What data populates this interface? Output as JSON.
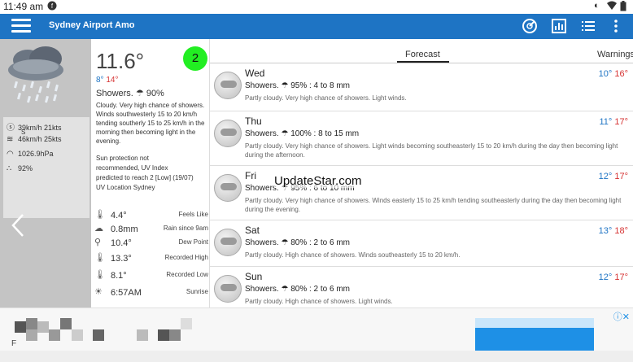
{
  "status_bar": {
    "time": "11:49 am"
  },
  "app_bar": {
    "title": "Sydney Airport Amo",
    "icons": [
      "menu-icon",
      "radar-icon",
      "chart-icon",
      "list-icon",
      "more-vert-icon"
    ]
  },
  "current": {
    "temp": "11.6°",
    "badge": "2",
    "min": "8°",
    "max": "14°",
    "summary": "Showers. ☂ 90%",
    "description": "Cloudy. Very high chance of showers. Winds southwesterly 15 to 20 km/h tending southerly 15 to 25 km/h in the morning then becoming light in the evening.",
    "sun_protection": "Sun protection not recommended, UV Index predicted to reach 2 [Low] (19/07)",
    "uv_location": "UV Location Sydney"
  },
  "left_stats": {
    "wind": "39km/h 21kts",
    "wind_dir": "S",
    "gust": "46km/h 25kts",
    "pressure": "1026.9hPa",
    "humidity": "92%"
  },
  "observations": [
    {
      "icon": "thermometer-person-icon",
      "value": "4.4°",
      "label": "Feels Like"
    },
    {
      "icon": "rain-cloud-icon",
      "value": "0.8mm",
      "label": "Rain since 9am"
    },
    {
      "icon": "dew-point-icon",
      "value": "10.4°",
      "label": "Dew Point"
    },
    {
      "icon": "thermometer-high-icon",
      "value": "13.3°",
      "label": "Recorded High"
    },
    {
      "icon": "thermometer-low-icon",
      "value": "8.1°",
      "label": "Recorded Low"
    },
    {
      "icon": "sunrise-icon",
      "value": "6:57AM",
      "label": "Sunrise"
    }
  ],
  "tabs": {
    "forecast": "Forecast",
    "warnings": "Warnings"
  },
  "forecast": [
    {
      "day": "Wed",
      "summary": "Showers. ☂ 95% : 4 to 8 mm",
      "desc": "Partly cloudy. Very high chance of showers. Light winds.",
      "min": "10°",
      "max": "16°"
    },
    {
      "day": "Thu",
      "summary": "Showers. ☂ 100% : 8 to 15 mm",
      "desc": "Partly cloudy. Very high chance of showers. Light winds becoming southeasterly 15 to 20 km/h during the day then becoming light during the afternoon.",
      "min": "11°",
      "max": "17°"
    },
    {
      "day": "Fri",
      "summary": "Showers. ☂ 95% : 6 to 10 mm",
      "desc": "Partly cloudy. Very high chance of showers. Winds easterly 15 to 25 km/h tending southeasterly during the day then becoming light during the evening.",
      "min": "12°",
      "max": "17°"
    },
    {
      "day": "Sat",
      "summary": "Showers. ☂ 80% : 2 to 6 mm",
      "desc": "Partly cloudy. High chance of showers. Winds southeasterly 15 to 20 km/h.",
      "min": "13°",
      "max": "18°"
    },
    {
      "day": "Sun",
      "summary": "Showers. ☂ 80% : 2 to 6 mm",
      "desc": "Partly cloudy. High chance of showers. Light winds.",
      "min": "12°",
      "max": "17°"
    }
  ],
  "watermark": "UpdateStar.com",
  "ad": {
    "letter": "F"
  },
  "colors": {
    "appbar": "#1e74c4",
    "min_temp": "#1e74c4",
    "max_temp": "#d63333",
    "badge": "#22ee22"
  }
}
